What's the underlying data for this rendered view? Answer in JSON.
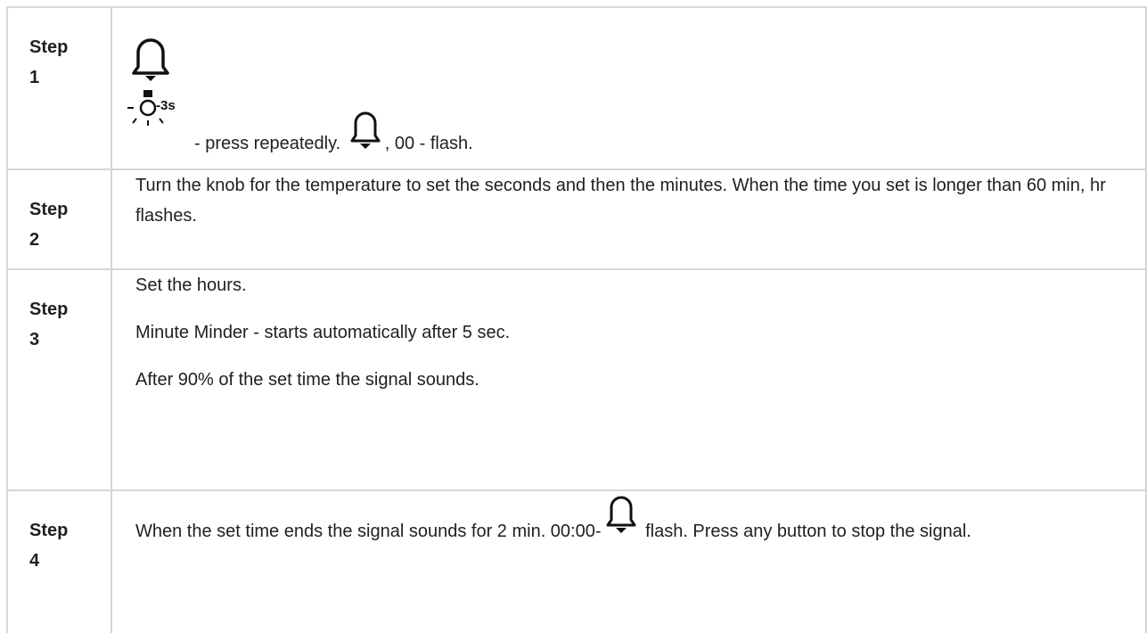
{
  "steps": [
    {
      "label_word": "Step",
      "label_num": "1",
      "display_label": "-3s",
      "after_display": "- press repeatedly.",
      "after_bell": ", 00 - flash."
    },
    {
      "label_word": "Step",
      "label_num": "2",
      "text": "Turn the knob for the temperature to set the seconds and then the minutes. When the time you set is longer than 60 min, hr flashes."
    },
    {
      "label_word": "Step",
      "label_num": "3",
      "lines": [
        "Set the hours.",
        "Minute Minder - starts automatically after 5 sec.",
        "After 90% of the set time the signal sounds."
      ]
    },
    {
      "label_word": "Step",
      "label_num": "4",
      "before_bell": "When the set time ends the signal sounds for 2 min. 00:00-",
      "after_bell": " flash. Press any button to stop the signal."
    }
  ],
  "icons": {
    "bell": "bell-icon",
    "light": "light-icon"
  },
  "colors": {
    "border": "#d6d6d6",
    "text": "#1f1f1f"
  }
}
